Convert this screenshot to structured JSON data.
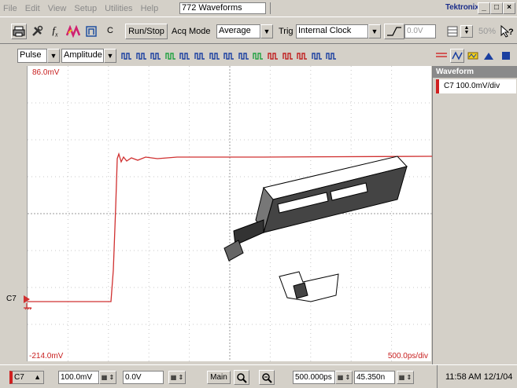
{
  "menubar": {
    "items": [
      "File",
      "Edit",
      "View",
      "Setup",
      "Utilities",
      "Help"
    ],
    "title": "772 Waveforms",
    "brand": "Tektronix",
    "min": "_",
    "max": "□",
    "close": "×"
  },
  "toolbar1": {
    "c_label": "C",
    "run_stop": "Run/Stop",
    "acq_mode_label": "Acq Mode",
    "acq_mode_value": "Average",
    "trig_label": "Trig",
    "trig_value": "Internal Clock",
    "trig_level": "0.0V",
    "zoom_pct": "50%"
  },
  "toolbar2": {
    "meas_type": "Pulse",
    "meas_param": "Amplitude"
  },
  "plot": {
    "top_ref": "86.0mV",
    "bottom_ref": "-214.0mV",
    "time_div": "500.0ps/div",
    "channel": "C7",
    "trace_color": "#d03030"
  },
  "panel": {
    "header": "Waveform",
    "channel_scale": "C7 100.0mV/div"
  },
  "statusbar": {
    "channel": "C7",
    "volts_div": "100.0mV",
    "offset": "0.0V",
    "main": "Main",
    "time_per_div": "500.000ps",
    "position": "45.350n",
    "datetime": "11:58 AM 12/1/04"
  }
}
